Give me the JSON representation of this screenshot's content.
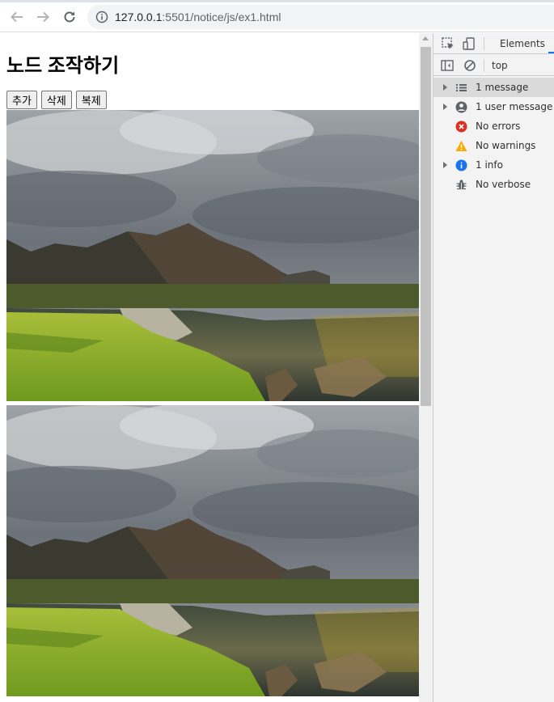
{
  "browser": {
    "url_host": "127.0.0.1",
    "url_path": ":5501/notice/js/ex1.html"
  },
  "page": {
    "heading": "노드 조작하기",
    "buttons": {
      "add": "추가",
      "delete": "삭제",
      "clone": "복제"
    },
    "images": [
      {
        "subject": "mountain lake landscape with autumn trees"
      },
      {
        "subject": "mountain lake landscape with autumn trees"
      }
    ]
  },
  "devtools": {
    "tab_elements": "Elements",
    "context": "top",
    "sidebar": [
      {
        "label": "1 message",
        "icon": "list-icon",
        "expandable": true,
        "selected": true
      },
      {
        "label": "1 user message",
        "icon": "user-icon",
        "expandable": true,
        "selected": false
      },
      {
        "label": "No errors",
        "icon": "error-icon",
        "expandable": false,
        "selected": false
      },
      {
        "label": "No warnings",
        "icon": "warning-icon",
        "expandable": false,
        "selected": false
      },
      {
        "label": "1 info",
        "icon": "info-icon",
        "expandable": true,
        "selected": false
      },
      {
        "label": "No verbose",
        "icon": "bug-icon",
        "expandable": false,
        "selected": false
      }
    ],
    "colors": {
      "error": "#d93025",
      "warning": "#f9ab00",
      "info": "#1a73e8",
      "selected_row": "#dadada"
    }
  }
}
